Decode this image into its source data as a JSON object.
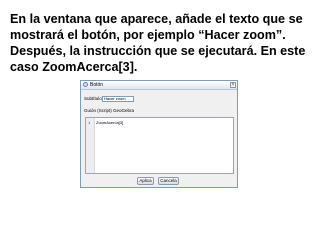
{
  "instruction_text": "En la ventana que aparece, añade el texto que se mostrará el botón, por ejemplo “Hacer zoom”. Después, la instrucción que se ejecutará. En este caso ZoomAcerca[3].",
  "dialog": {
    "title": "Botón",
    "close_glyph": "×",
    "caption_label": "Subtítulo:",
    "caption_value": "Hacer zoom",
    "script_label": "Guión (Script) GeoGebra",
    "script_lines": [
      {
        "number": "1",
        "code": "ZoomAcerca[3]"
      }
    ],
    "apply_label": "Aplica",
    "cancel_label": "Cancela"
  }
}
